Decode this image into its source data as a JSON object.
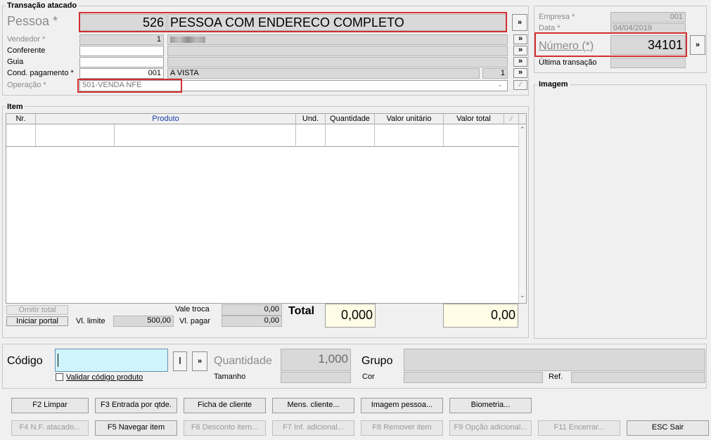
{
  "transacao": {
    "title": "Transação atacado",
    "pessoa_label": "Pessoa *",
    "pessoa_code": "526",
    "pessoa_name": "PESSOA COM ENDERECO COMPLETO",
    "vendedor_label": "Vendedor *",
    "vendedor_code": "1",
    "conferente_label": "Conferente",
    "guia_label": "Guia",
    "cond_pagamento_label": "Cond. pagamento *",
    "cond_pagamento_code": "001",
    "cond_pagamento_name": "A VISTA",
    "cond_pagamento_parcelas": "1",
    "operacao_label": "Operação *",
    "operacao_value": "501-VENDA NFE",
    "more_button": "»"
  },
  "right_panel": {
    "empresa_label": "Empresa *",
    "empresa_value": "001",
    "data_label": "Data *",
    "data_value": "04/04/2019",
    "numero_label": "Número (*)",
    "numero_value": "34101",
    "ultima_label": "Última transação",
    "imagem_title": "Imagem"
  },
  "item": {
    "title": "Item",
    "columns": [
      "Nr.",
      "Produto",
      "Und.",
      "Quantidade",
      "Valor unitário",
      "Valor total"
    ]
  },
  "totals": {
    "omitir_total": "Omitir total",
    "iniciar_portal": "Iniciar portal",
    "vl_limite_label": "Vl. limite",
    "vl_limite_value": "500,00",
    "vale_troca_label": "Vale troca",
    "vale_troca_value": "0,00",
    "vl_pagar_label": "Vl. pagar",
    "vl_pagar_value": "0,00",
    "total_label": "Total",
    "total_qty": "0,000",
    "total_value": "0,00"
  },
  "codigo": {
    "codigo_label": "Código",
    "i_button": "I",
    "more_button": "»",
    "validar_label": "Validar código produto",
    "quantidade_label": "Quantidade",
    "quantidade_value": "1,000",
    "tamanho_label": "Tamanho",
    "grupo_label": "Grupo",
    "cor_label": "Cor",
    "ref_label": "Ref."
  },
  "buttons_row1": [
    "F2 Limpar",
    "F3 Entrada por qtde.",
    "Ficha de cliente",
    "Mens. cliente...",
    "Imagem pessoa...",
    "Biometria..."
  ],
  "buttons_row2": [
    "F4 N.F. atacado...",
    "F5 Navegar item",
    "F6 Desconto item...",
    "F7 Inf. adicional...",
    "F8 Remover item",
    "F9 Opção adicional...",
    "F11 Encerrar...",
    "ESC Sair"
  ]
}
